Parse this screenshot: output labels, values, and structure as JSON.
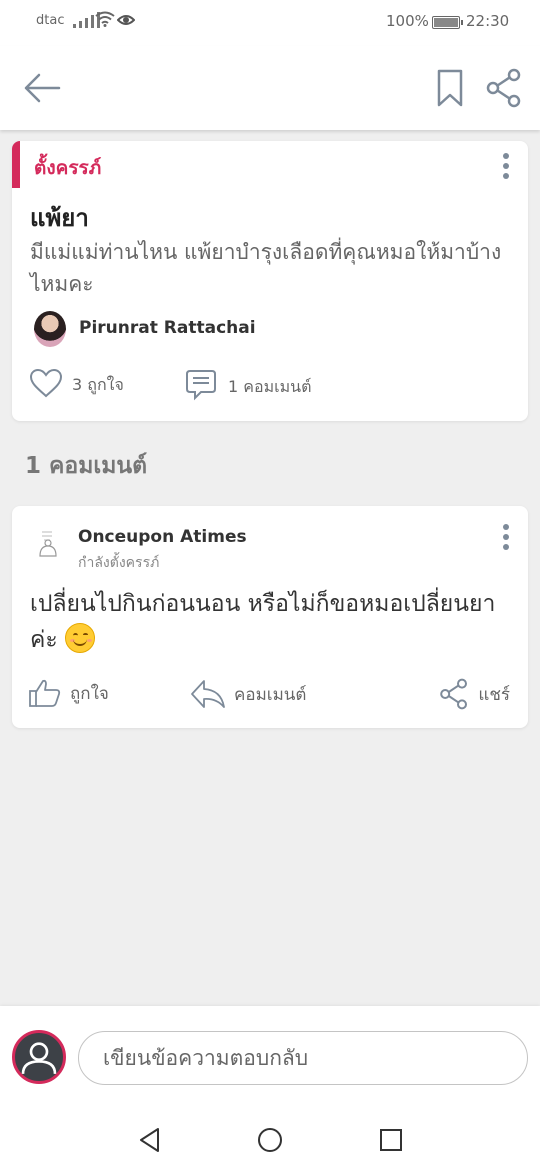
{
  "status_bar": {
    "carrier": "dtac",
    "battery": "100%",
    "time": "22:30"
  },
  "post": {
    "category": "ตั้งครรภ์",
    "title": "แพ้ยา",
    "body": "มีแม่แม่ท่านไหน แพ้ยาบำรุงเลือดที่คุณหมอให้มาบ้างไหมคะ",
    "author": "Pirunrat Rattachai",
    "likes_label": "3 ถูกใจ",
    "comments_label": "1 คอมเมนต์",
    "accent_color": "#d42a5b"
  },
  "comments_section": {
    "title": "1 คอมเมนต์"
  },
  "comments": [
    {
      "author": "Onceupon Atimes",
      "status": "กำลังตั้งครรภ์",
      "text": "เปลี่ยนไปกินก่อนนอน หรือไม่ก็ขอหมอเปลี่ยนยาค่ะ",
      "emoji": "smiling-face",
      "like_label": "ถูกใจ",
      "reply_label": "คอมเมนต์",
      "share_label": "แชร์"
    }
  ],
  "compose": {
    "placeholder": "เขียนข้อความตอบกลับ"
  },
  "icons": [
    "back-arrow-icon",
    "bookmark-icon",
    "share-icon",
    "more-vert-icon",
    "heart-icon",
    "comment-bubble-icon",
    "thumbs-up-icon",
    "reply-icon",
    "user-icon"
  ]
}
